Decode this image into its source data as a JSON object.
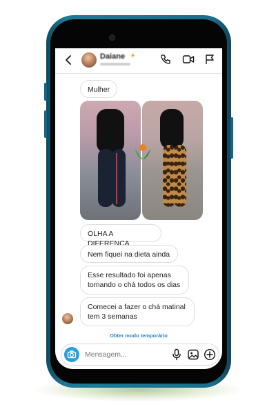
{
  "contact": {
    "name": "Daiane",
    "name_emoji": "☀"
  },
  "messages": [
    {
      "text": "Mulher"
    },
    {
      "text": "OLHA A DIFERENÇA"
    },
    {
      "text": "Nem fiquei na dieta ainda"
    },
    {
      "text": "Esse resultado foi apenas tomando o chá todos os dias"
    },
    {
      "text": "Comecei a fazer o chá matinal tem 3 semanas"
    }
  ],
  "temporary_mode_link": "Obter modo temporário",
  "input": {
    "placeholder": "Mensagem..."
  },
  "icons": {
    "back": "chevron-left-icon",
    "call": "phone-icon",
    "video": "video-icon",
    "report": "flag-icon",
    "camera": "camera-icon",
    "mic": "microphone-icon",
    "gallery": "image-icon",
    "add": "plus-circle-icon"
  },
  "colors": {
    "phone_frame": "#1a6f8b",
    "accent_blue": "#2a9fe0",
    "link_blue": "#2b86c5"
  }
}
